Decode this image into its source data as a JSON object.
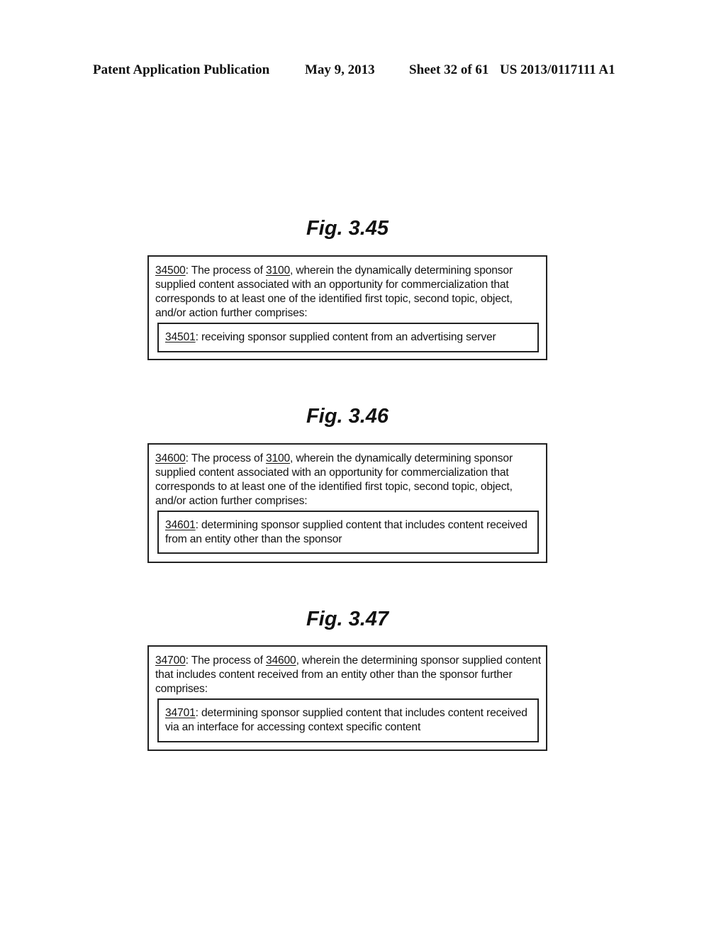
{
  "header": {
    "publication": "Patent Application Publication",
    "date": "May 9, 2013",
    "sheet": "Sheet 32 of 61",
    "number": "US 2013/0117111 A1"
  },
  "figures": [
    {
      "title": "Fig. 3.45",
      "outer": {
        "ref": "34500",
        "prefix": ": The process of ",
        "parent_ref": "3100",
        "body": ", wherein the dynamically determining sponsor supplied content associated with an opportunity for commercialization that corresponds to at least one of the identified first topic, second topic, object, and/or action further comprises:"
      },
      "inner": {
        "ref": "34501",
        "body": ": receiving sponsor supplied content from an advertising server"
      }
    },
    {
      "title": "Fig. 3.46",
      "outer": {
        "ref": "34600",
        "prefix": ": The process of ",
        "parent_ref": "3100",
        "body": ", wherein the dynamically determining sponsor supplied content associated with an opportunity for commercialization that corresponds to at least one of the identified first topic, second topic, object, and/or action further comprises:"
      },
      "inner": {
        "ref": "34601",
        "body": ": determining sponsor supplied content that includes content received from an entity other than the sponsor"
      }
    },
    {
      "title": "Fig. 3.47",
      "outer": {
        "ref": "34700",
        "prefix": ": The process of ",
        "parent_ref": "34600",
        "body": ", wherein the determining sponsor supplied content that includes content received from an entity other than the sponsor further comprises:"
      },
      "inner": {
        "ref": "34701",
        "body": ": determining sponsor supplied content that includes content received via an interface for accessing context specific content"
      }
    }
  ]
}
